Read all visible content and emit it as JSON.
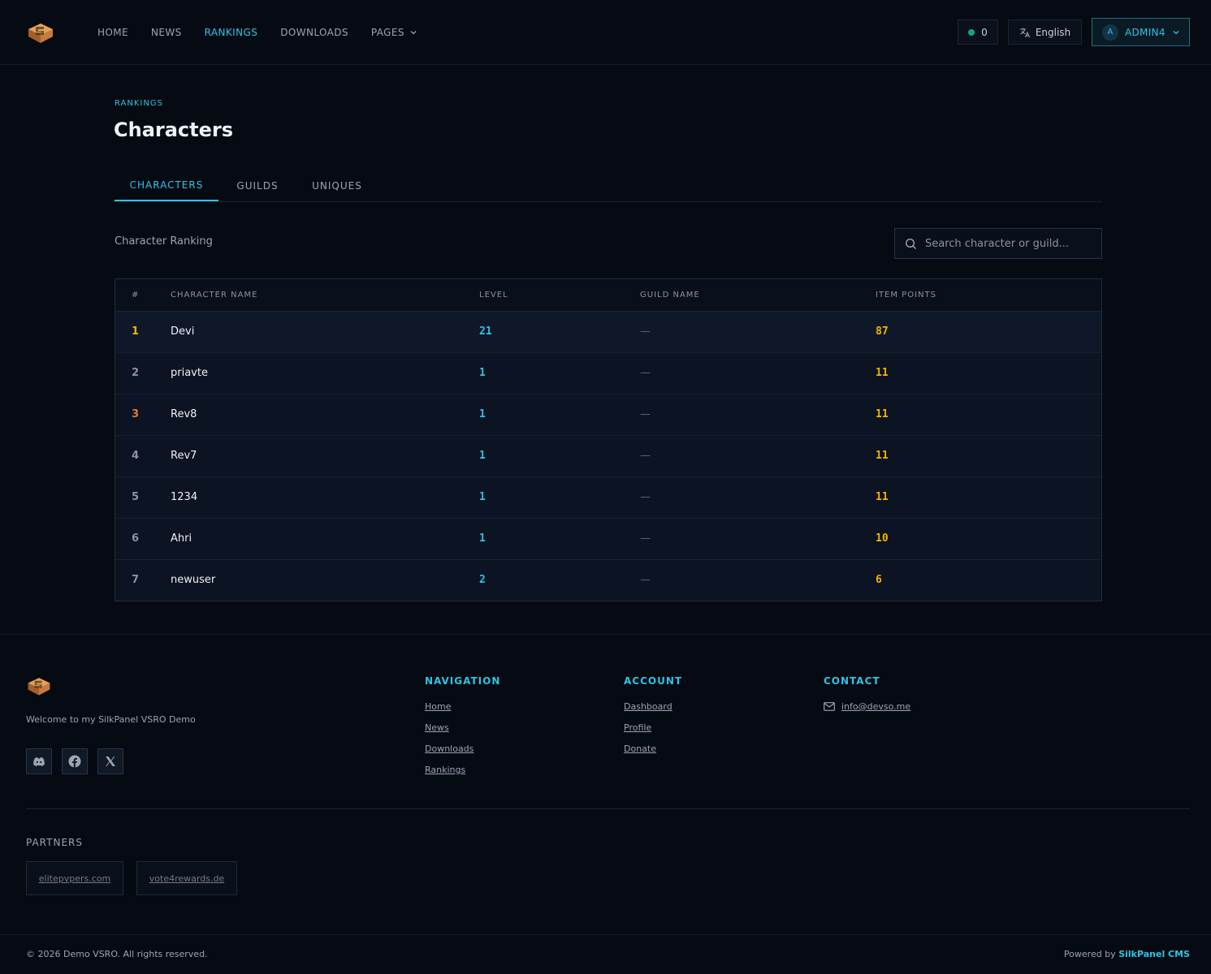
{
  "nav": {
    "items": [
      {
        "label": "HOME",
        "active": false
      },
      {
        "label": "NEWS",
        "active": false
      },
      {
        "label": "RANKINGS",
        "active": true
      },
      {
        "label": "DOWNLOADS",
        "active": false
      },
      {
        "label": "PAGES",
        "active": false
      }
    ],
    "online_count": "0",
    "language": "English",
    "user": {
      "initial": "A",
      "name": "ADMIN4"
    }
  },
  "page": {
    "eyebrow": "RANKINGS",
    "title": "Characters",
    "tabs": [
      "CHARACTERS",
      "GUILDS",
      "UNIQUES"
    ],
    "active_tab": "CHARACTERS",
    "section_label": "Character Ranking",
    "search_placeholder": "Search character or guild..."
  },
  "table": {
    "headers": [
      "#",
      "CHARACTER NAME",
      "LEVEL",
      "GUILD NAME",
      "ITEM POINTS"
    ],
    "rows": [
      {
        "rank": "1",
        "name": "Devi",
        "level": "21",
        "guild": "—",
        "points": "87"
      },
      {
        "rank": "2",
        "name": "priavte",
        "level": "1",
        "guild": "—",
        "points": "11"
      },
      {
        "rank": "3",
        "name": "Rev8",
        "level": "1",
        "guild": "—",
        "points": "11"
      },
      {
        "rank": "4",
        "name": "Rev7",
        "level": "1",
        "guild": "—",
        "points": "11"
      },
      {
        "rank": "5",
        "name": "1234",
        "level": "1",
        "guild": "—",
        "points": "11"
      },
      {
        "rank": "6",
        "name": "Ahri",
        "level": "1",
        "guild": "—",
        "points": "10"
      },
      {
        "rank": "7",
        "name": "newuser",
        "level": "2",
        "guild": "—",
        "points": "6"
      }
    ]
  },
  "footer": {
    "welcome": "Welcome to my SilkPanel VSRO Demo",
    "navigation": {
      "title": "NAVIGATION",
      "links": [
        "Home",
        "News",
        "Downloads",
        "Rankings"
      ]
    },
    "account": {
      "title": "ACCOUNT",
      "links": [
        "Dashboard",
        "Profile",
        "Donate"
      ]
    },
    "contact": {
      "title": "CONTACT",
      "email": "info@devso.me"
    },
    "partners_title": "PARTNERS",
    "partners": [
      "elitepvpers.com",
      "vote4rewards.de"
    ],
    "copyright": "© 2026 Demo VSRO. All rights reserved.",
    "powered_prefix": "Powered by",
    "powered_brand": "SilkPanel CMS"
  },
  "colors": {
    "accent": "#2ec4e6",
    "gold": "#f4b400",
    "bronze": "#e07b39",
    "background": "#060a12"
  }
}
